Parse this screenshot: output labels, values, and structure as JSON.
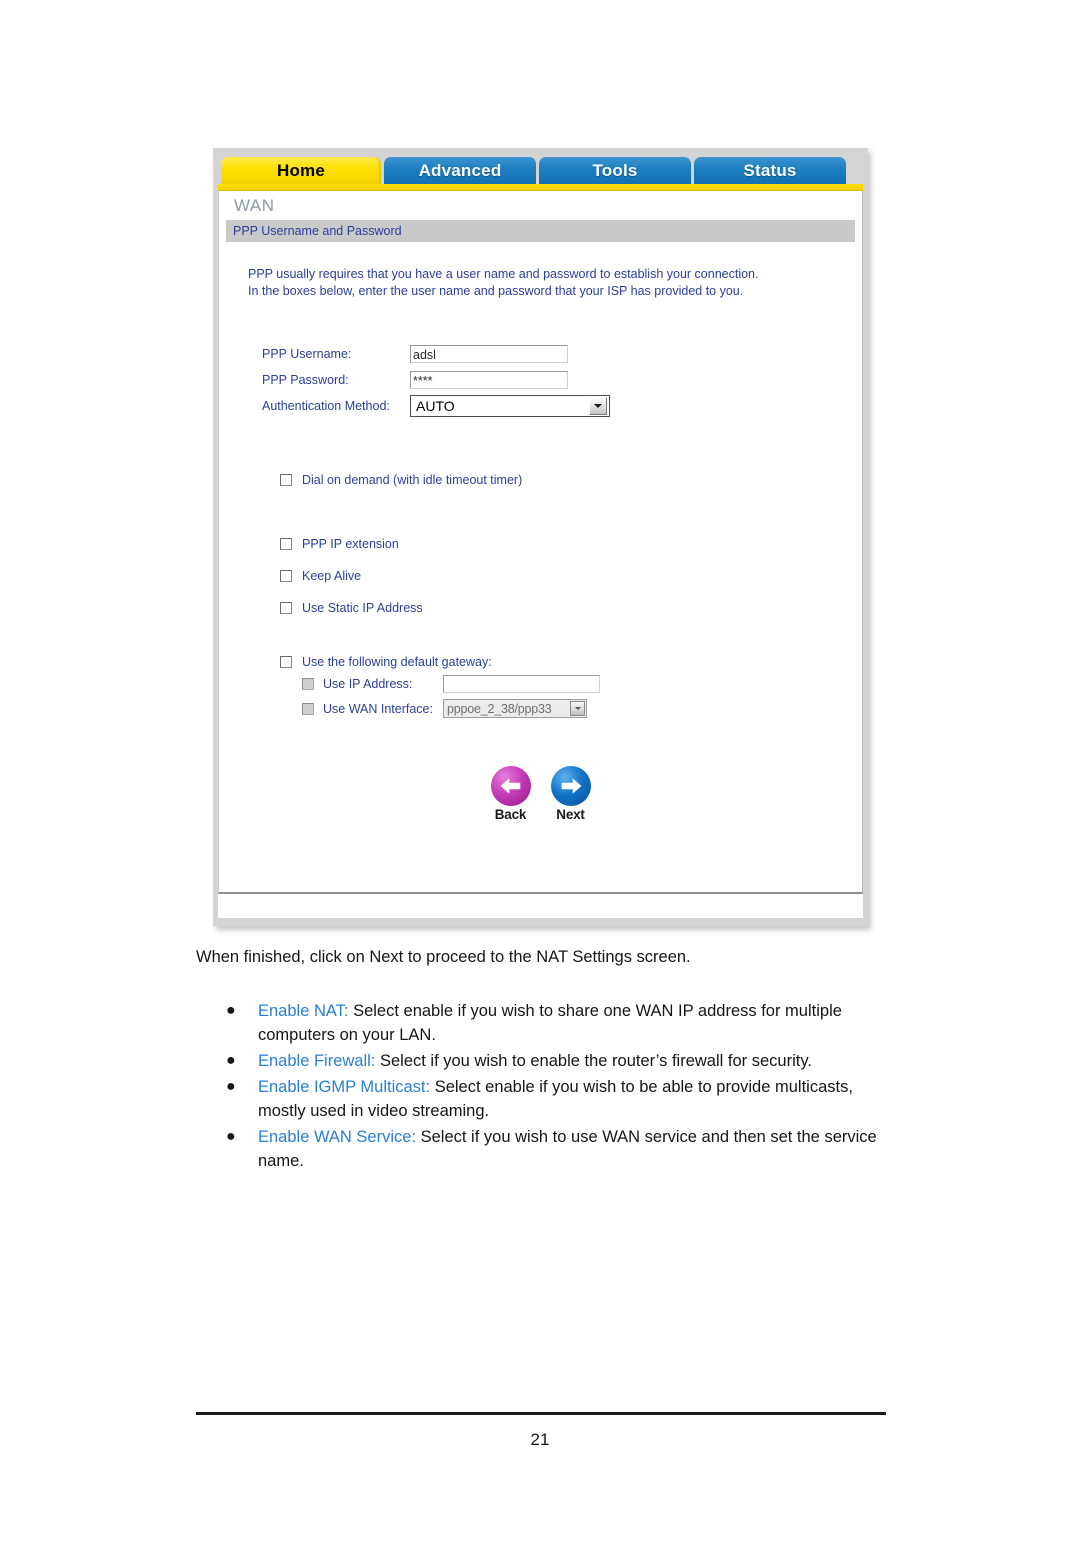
{
  "router_ui": {
    "tabs": [
      {
        "label": "Home",
        "active": true
      },
      {
        "label": "Advanced",
        "active": false
      },
      {
        "label": "Tools",
        "active": false
      },
      {
        "label": "Status",
        "active": false
      }
    ],
    "page_title": "WAN",
    "section_title": "PPP Username and Password",
    "intro_text": "PPP usually requires that you have a user name and password to establish your connection.\nIn the boxes below, enter the user name and password that your ISP has provided to you.",
    "fields": {
      "username_label": "PPP Username:",
      "username_value": "adsl",
      "password_label": "PPP Password:",
      "password_value": "****",
      "auth_label": "Authentication Method:",
      "auth_value": "AUTO"
    },
    "checkboxes": {
      "dial_on_demand": "Dial on demand (with idle timeout timer)",
      "ppp_ip_extension": "PPP IP extension",
      "keep_alive": "Keep Alive",
      "use_static_ip": "Use Static IP Address",
      "use_default_gateway": "Use the following default gateway:",
      "use_ip_address": "Use IP Address:",
      "use_wan_interface": "Use WAN Interface:"
    },
    "gateway": {
      "ip_value": "",
      "wan_interface_value": "pppoe_2_38/ppp33"
    },
    "nav": {
      "back_label": "Back",
      "next_label": "Next"
    },
    "colors": {
      "active_tab": "#ffe100",
      "inactive_tab": "#1c7ec0",
      "label_blue": "#2b3f98",
      "section_bar": "#c9c9c9",
      "back_button": "#c63bb8",
      "next_button": "#1273c9"
    }
  },
  "document": {
    "intro_paragraph": "When finished, click on Next to proceed to the NAT Settings screen.",
    "bullets": [
      {
        "term": "Enable NAT:",
        "text": " Select enable if you wish to share one WAN IP address for multiple computers on your LAN."
      },
      {
        "term": "Enable Firewall:",
        "text": " Select if you wish to enable the router’s firewall for security."
      },
      {
        "term": "Enable IGMP Multicast:",
        "text": " Select enable if you wish to be able to provide multicasts, mostly used in video streaming."
      },
      {
        "term": "Enable WAN Service:",
        "text": " Select if you wish to use WAN service and then set the service name."
      }
    ],
    "page_number": "21",
    "bullet_marker": "●",
    "term_color": "#2a7fd4"
  }
}
